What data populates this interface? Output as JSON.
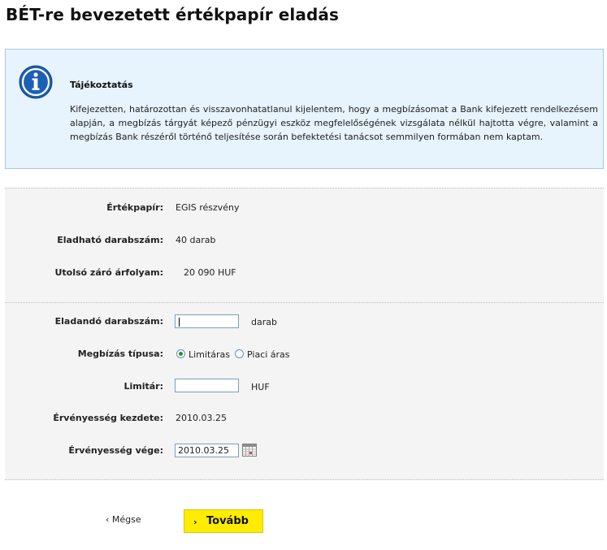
{
  "page": {
    "title": "BÉT-re bevezetett értékpapír eladás"
  },
  "info": {
    "icon": "info-icon",
    "title": "Tájékoztatás",
    "text": "Kifejezetten, határozottan és visszavonhatatlanul kijelentem, hogy a megbízásomat a Bank kifejezett rendelkezésem alapján, a megbízás tárgyát képező pénzügyi eszköz megfelelőségének vizsgálata nélkül hajtotta végre, valamint a megbízás Bank részéről történő teljesítése során befektetési tanácsot semmilyen formában nem kaptam.",
    "accent_color": "#e7f3fd",
    "icon_color": "#1c5fb5"
  },
  "details": {
    "security_label": "Értékpapír:",
    "security_value": "EGIS részvény",
    "sellable_label": "Eladható darabszám:",
    "sellable_value": "40 darab",
    "last_close_label": "Utolsó záró árfolyam:",
    "last_close_value": "20 090 HUF"
  },
  "form": {
    "quantity_label": "Eladandó darabszám:",
    "quantity_value": "",
    "quantity_unit": "darab",
    "order_type_label": "Megbízás típusa:",
    "order_type_options": [
      "Limitáras",
      "Piaci áras"
    ],
    "order_type_selected": "Limitáras",
    "limit_label": "Limitár:",
    "limit_value": "",
    "limit_unit": "HUF",
    "valid_from_label": "Érvényesség kezdete:",
    "valid_from_value": "2010.03.25",
    "valid_to_label": "Érvényesség vége:",
    "valid_to_value": "2010.03.25",
    "calendar_icon": "calendar-icon"
  },
  "actions": {
    "back_label": "Mégse",
    "back_icon": "‹",
    "next_label": "Tovább",
    "next_icon": "›",
    "next_color": "#ffec00"
  }
}
